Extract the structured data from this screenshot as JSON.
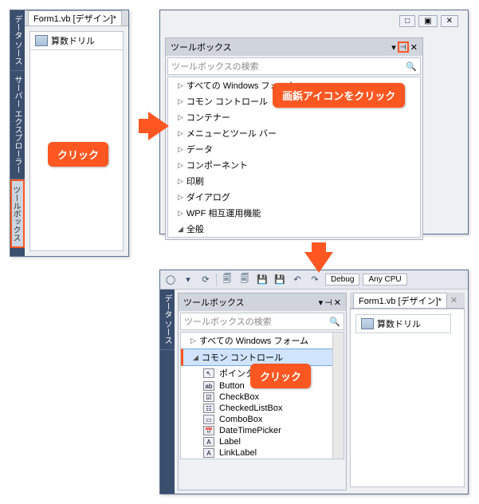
{
  "panel1": {
    "vtabs": [
      "データ ソース",
      "サーバー エクスプローラー",
      "ツールボックス"
    ],
    "file_tab": "Form1.vb [デザイン]*",
    "work_title": "算数ドリル"
  },
  "panel2": {
    "toolbox_title": "ツールボックス",
    "search_placeholder": "ツールボックスの検索",
    "categories": [
      {
        "label": "すべての Windows フォーム",
        "exp": false
      },
      {
        "label": "コモン コントロール",
        "exp": false
      },
      {
        "label": "コンテナー",
        "exp": false
      },
      {
        "label": "メニューとツール バー",
        "exp": false
      },
      {
        "label": "データ",
        "exp": false
      },
      {
        "label": "コンポーネント",
        "exp": false
      },
      {
        "label": "印刷",
        "exp": false
      },
      {
        "label": "ダイアログ",
        "exp": false
      },
      {
        "label": "WPF 相互運用機能",
        "exp": false
      },
      {
        "label": "全般",
        "exp": true
      }
    ],
    "winbox_btns": [
      "□",
      "▣",
      "✕"
    ]
  },
  "panel3": {
    "toolbar": {
      "nav": [
        "◯",
        "▾",
        "⟳"
      ],
      "icons": [
        "🗐",
        "🗐",
        "💾",
        "💾",
        "↶",
        "↷"
      ],
      "config": "Debug",
      "platform": "Any CPU"
    },
    "vtab": "データ ソース",
    "toolbox_title": "ツールボックス",
    "search_placeholder": "ツールボックスの検索",
    "pin_glyph": "⊣",
    "close_glyph": "✕",
    "mag_glyph": "🔍",
    "dropdown_glyph": "▾",
    "categories": [
      {
        "label": "すべての Windows フォーム",
        "exp": false
      },
      {
        "label": "コモン コントロール",
        "exp": true
      }
    ],
    "tools": [
      {
        "icon": "↖",
        "label": "ポインター"
      },
      {
        "icon": "ab",
        "label": "Button"
      },
      {
        "icon": "☑",
        "label": "CheckBox"
      },
      {
        "icon": "☷",
        "label": "CheckedListBox"
      },
      {
        "icon": "▭",
        "label": "ComboBox"
      },
      {
        "icon": "📅",
        "label": "DateTimePicker"
      },
      {
        "icon": "A",
        "label": "Label"
      },
      {
        "icon": "A",
        "label": "LinkLabel"
      }
    ],
    "file_tab": "Form1.vb [デザイン]*",
    "work_title": "算数ドリル"
  },
  "callouts": {
    "click1": "クリック",
    "pin_msg": "画鋲アイコンをクリック",
    "click3": "クリック"
  }
}
